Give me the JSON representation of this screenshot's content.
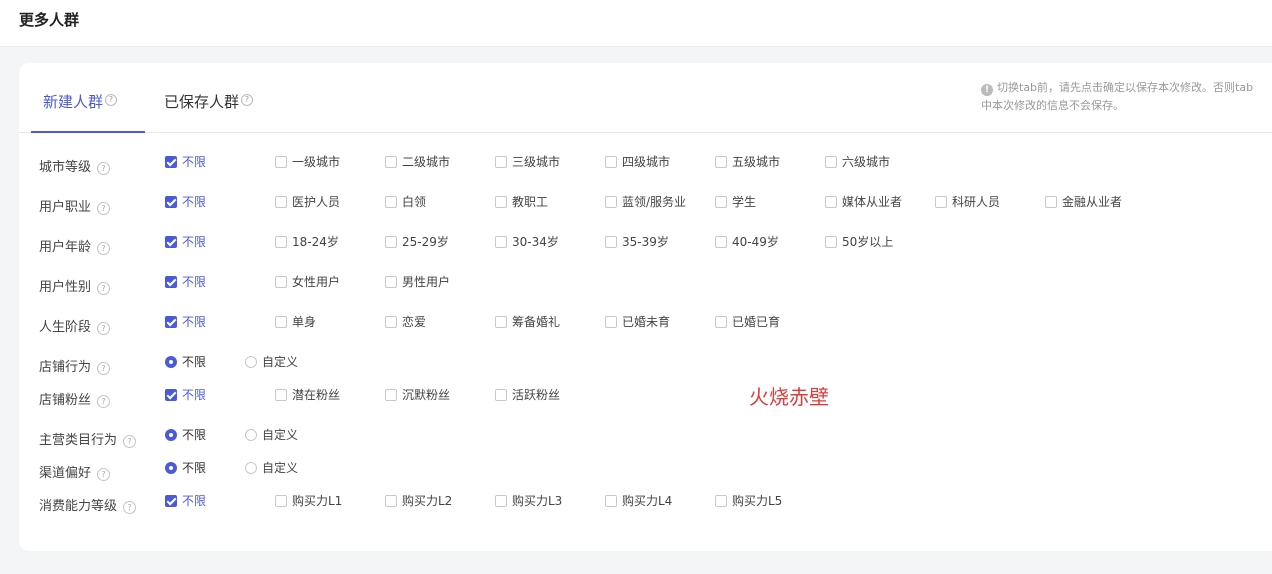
{
  "header": {
    "title": "更多人群"
  },
  "tabs": [
    {
      "label": "新建人群",
      "active": true
    },
    {
      "label": "已保存人群",
      "active": false
    }
  ],
  "notice": {
    "line1": "切换tab前，请先点击确定以保存本次修改。否则tab",
    "line2": "中本次修改的信息不会保存。"
  },
  "watermark": "火烧赤壁",
  "help_glyph": "?",
  "rows": [
    {
      "label": "城市等级",
      "type": "checkbox",
      "options": [
        "不限",
        "一级城市",
        "二级城市",
        "三级城市",
        "四级城市",
        "五级城市",
        "六级城市"
      ]
    },
    {
      "label": "用户职业",
      "type": "checkbox",
      "options": [
        "不限",
        "医护人员",
        "白领",
        "教职工",
        "蓝领/服务业",
        "学生",
        "媒体从业者",
        "科研人员",
        "金融从业者"
      ]
    },
    {
      "label": "用户年龄",
      "type": "checkbox",
      "options": [
        "不限",
        "18-24岁",
        "25-29岁",
        "30-34岁",
        "35-39岁",
        "40-49岁",
        "50岁以上"
      ]
    },
    {
      "label": "用户性别",
      "type": "checkbox",
      "options": [
        "不限",
        "女性用户",
        "男性用户"
      ]
    },
    {
      "label": "人生阶段",
      "type": "checkbox",
      "options": [
        "不限",
        "单身",
        "恋爱",
        "筹备婚礼",
        "已婚未育",
        "已婚已育"
      ]
    },
    {
      "label": "店铺行为",
      "type": "radio",
      "options": [
        "不限",
        "自定义"
      ]
    },
    {
      "label": "店铺粉丝",
      "type": "checkbox",
      "options": [
        "不限",
        "潜在粉丝",
        "沉默粉丝",
        "活跃粉丝"
      ]
    },
    {
      "label": "主营类目行为",
      "type": "radio",
      "options": [
        "不限",
        "自定义"
      ]
    },
    {
      "label": "渠道偏好",
      "type": "radio",
      "options": [
        "不限",
        "自定义"
      ]
    },
    {
      "label": "消费能力等级",
      "type": "checkbox",
      "options": [
        "不限",
        "购买力L1",
        "购买力L2",
        "购买力L3",
        "购买力L4",
        "购买力L5"
      ]
    }
  ]
}
